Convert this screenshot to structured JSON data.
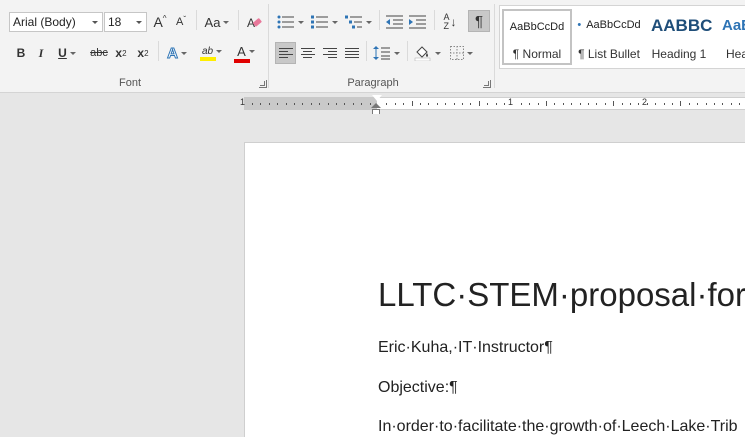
{
  "font_group": {
    "label": "Font",
    "font_name": "Arial (Body)",
    "font_size": "18",
    "grow_label": "A",
    "shrink_label": "A",
    "change_case_label": "Aa",
    "bold_label": "B",
    "italic_label": "I",
    "underline_label": "U",
    "strike_label": "abc",
    "subscript_label": "x",
    "subscript_mark": "2",
    "superscript_label": "x",
    "superscript_mark": "2",
    "effects_label": "A",
    "highlight_label": "ab",
    "font_color_label": "A",
    "highlight_color": "#ffee00",
    "font_color": "#e00000"
  },
  "paragraph_group": {
    "label": "Paragraph",
    "sort_label": "A",
    "sort_label_2": "Z",
    "pilcrow_label": "¶"
  },
  "styles_gallery": {
    "items": [
      {
        "sample": "AaBbCcDd",
        "name": "¶ Normal",
        "selected": true
      },
      {
        "sample": "AaBbCcDd",
        "name": "¶ List Bullet"
      },
      {
        "sample": "AABBC",
        "name": "Heading 1"
      },
      {
        "sample": "AaBb",
        "name": "Hea"
      }
    ],
    "list_bullet_prefix": "•",
    "heading_color": "#1f4e79",
    "heading2_color": "#2e74b5"
  },
  "ruler": {
    "labels": [
      "1",
      "1",
      "2"
    ]
  },
  "document": {
    "title": "LLTC·STEM·proposal·for",
    "paragraphs": [
      "Eric·Kuha,·IT·Instructor¶",
      "Objective:¶",
      "In·order·to·facilitate·the·growth·of·Leech·Lake·Trib"
    ]
  }
}
